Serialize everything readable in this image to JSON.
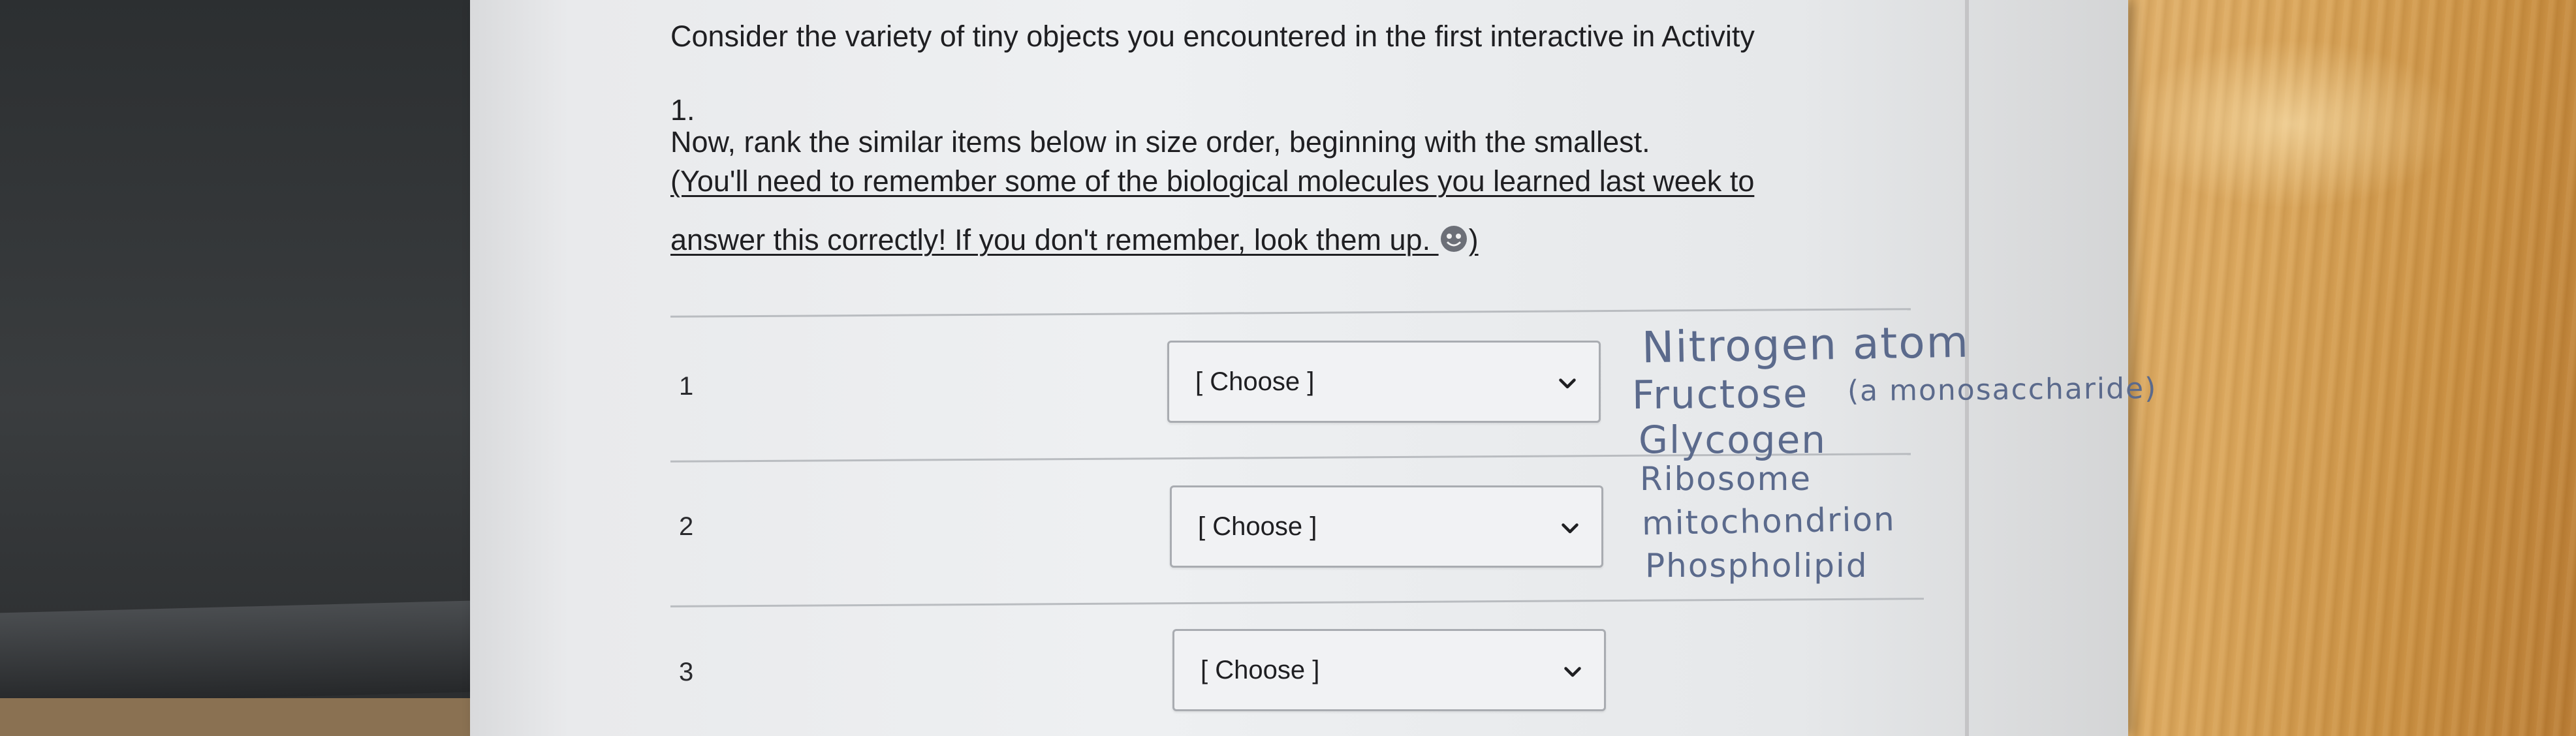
{
  "instructions": {
    "line1": "Consider the variety of tiny objects you encountered in the first interactive in Activity",
    "line2": "1.",
    "line3": "Now, rank the similar items below in size order, beginning with the smallest.",
    "line4": "(You'll need to remember some of the biological molecules you learned last week to",
    "line5_text": "answer this correctly! If you don't remember, look them up. ",
    "line5_close": ")",
    "emoji_icon": "smiley-face-icon"
  },
  "rows": [
    {
      "number": "1",
      "select_value": "[ Choose ]"
    },
    {
      "number": "2",
      "select_value": "[ Choose ]"
    },
    {
      "number": "3",
      "select_value": "[ Choose ]"
    }
  ],
  "handwritten_notes": [
    "Nitrogen atom",
    "Fructose",
    "(a monosaccharide)",
    "Glycogen",
    "Ribosome",
    "mitochondrion",
    "Phospholipid"
  ],
  "colors": {
    "paper": "#eef0f2",
    "ink": "#5b6a8c",
    "text": "#1f1f22"
  }
}
